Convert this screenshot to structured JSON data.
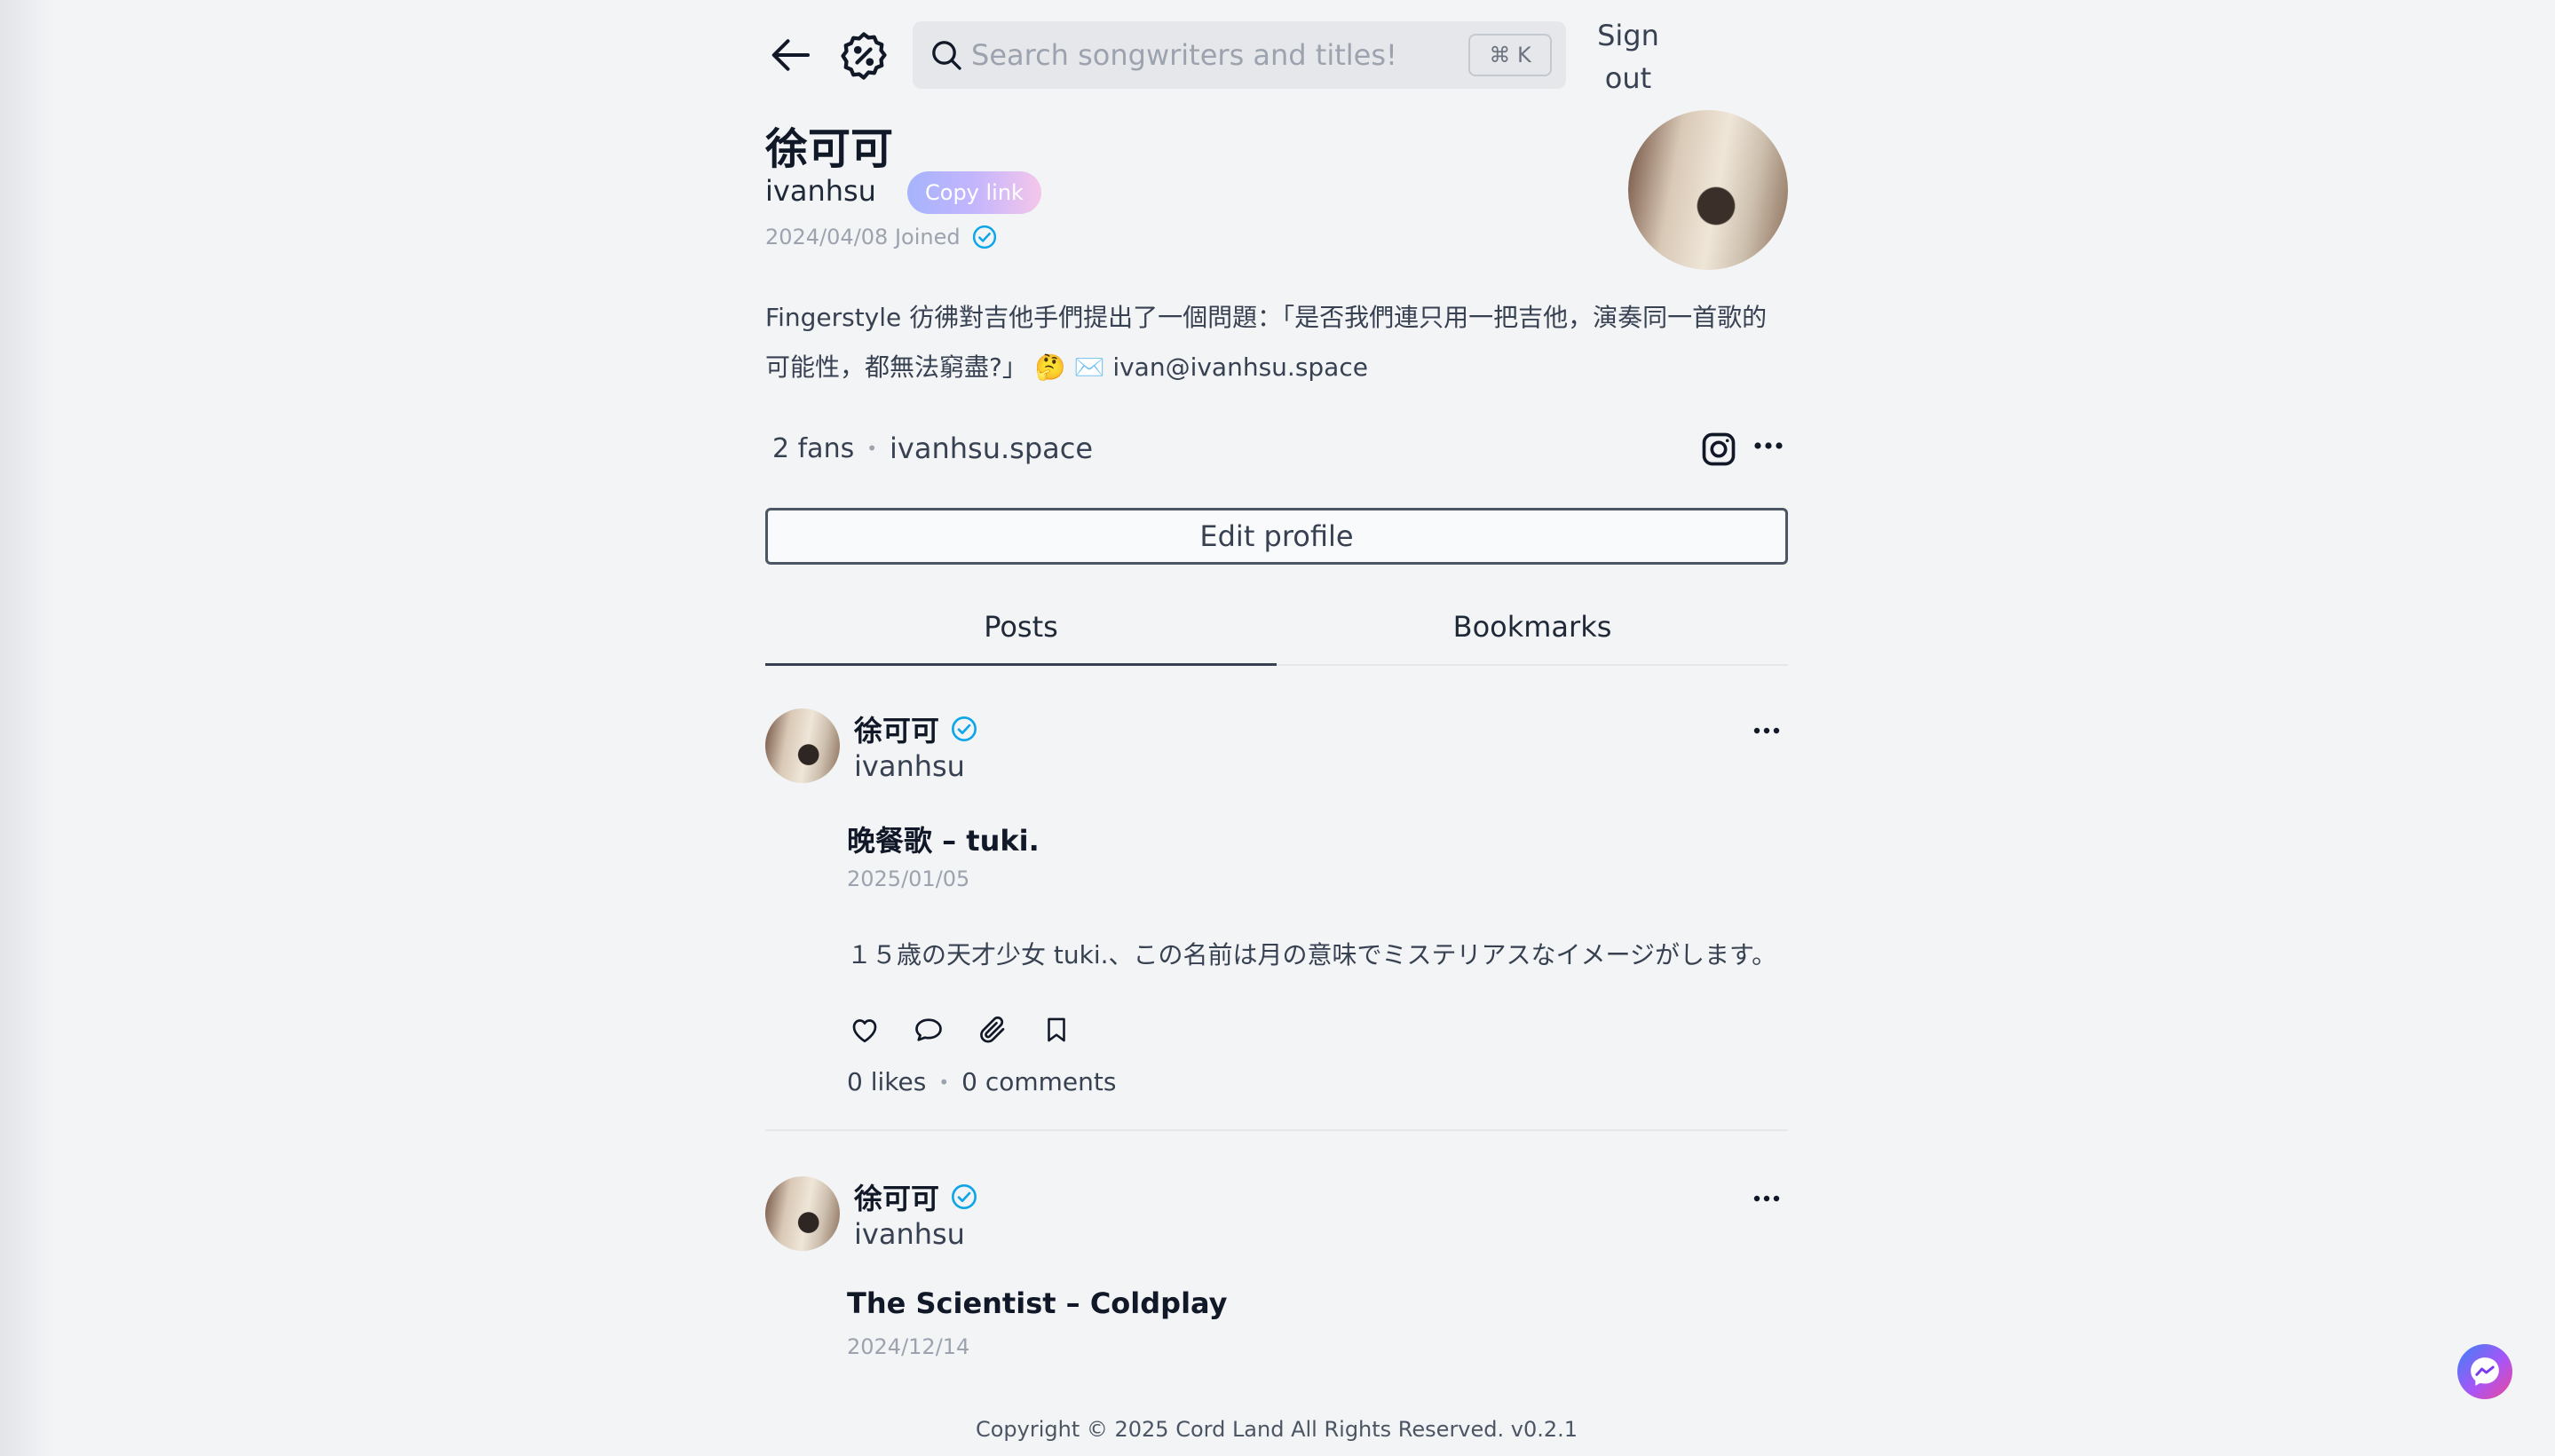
{
  "header": {
    "search_placeholder": "Search songwriters and titles!",
    "shortcut": "⌘ K",
    "signout_label": "Sign out"
  },
  "profile": {
    "name": "徐可可",
    "handle": "ivanhsu",
    "copy_link_label": "Copy link",
    "joined": "2024/04/08 Joined",
    "bio_text": "Fingerstyle 彷彿對吉他手們提出了一個問題：「是否我們連只用一把吉他，演奏同一首歌的可能性，都無法窮盡?」",
    "bio_emoji": "🤔 ✉️",
    "bio_email": "ivan@ivanhsu.space",
    "fans": "2 fans",
    "website": "ivanhsu.space",
    "edit_label": "Edit profile"
  },
  "tabs": [
    {
      "label": "Posts",
      "active": true
    },
    {
      "label": "Bookmarks",
      "active": false
    }
  ],
  "posts": [
    {
      "author": "徐可可",
      "handle": "ivanhsu",
      "title": "晚餐歌 – tuki.",
      "date": "2025/01/05",
      "body": "１５歳の天才少女 tuki.、この名前は月の意味でミステリアスなイメージがします。",
      "likes": "0 likes",
      "comments": "0 comments"
    },
    {
      "author": "徐可可",
      "handle": "ivanhsu",
      "title": "The Scientist – Coldplay",
      "date": "2024/12/14"
    }
  ],
  "footer": "Copyright © 2025 Cord Land All Rights Reserved. v0.2.1",
  "colors": {
    "background": "#f3f4f6",
    "verified": "#0ea5e9",
    "text": "#1f2937",
    "muted": "#9ca3af"
  }
}
